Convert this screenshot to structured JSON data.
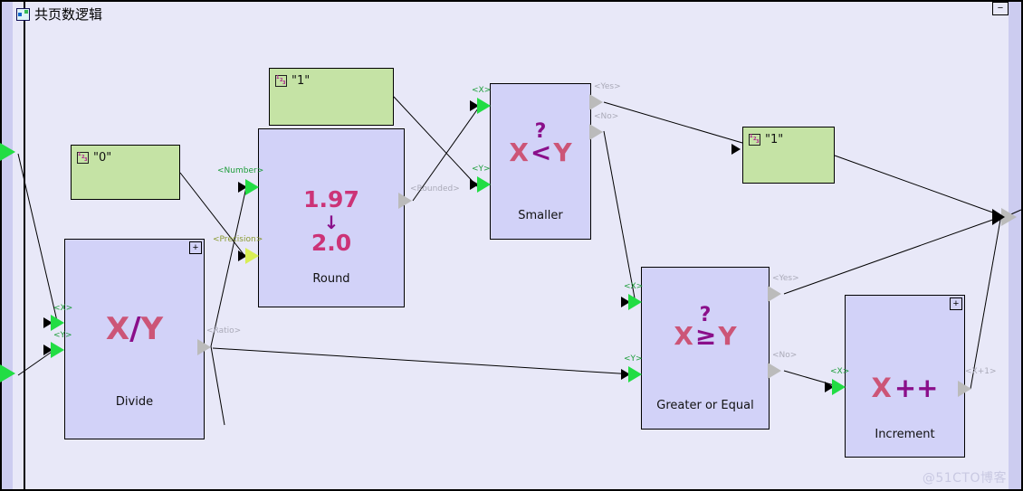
{
  "window": {
    "title": "共页数逻辑",
    "title_icon": "diagram-icon",
    "minimize_label": "−"
  },
  "watermark": "@51CTO博客",
  "colors": {
    "canvas_bg": "#e8e8f8",
    "node_fill": "#d2d2f8",
    "constant_fill": "#c5e3a5",
    "glyph_pink": "#cc4477",
    "glyph_purple": "#8a0f8a",
    "input_port": "#22dd44",
    "optional_port": "#d8ee55",
    "output_port": "#bbbbbb"
  },
  "nodes": [
    {
      "id": "divide",
      "label": "Divide",
      "glyph": "X/Y",
      "expander": "+",
      "inputs": [
        {
          "label": "<X>",
          "kind": "required"
        },
        {
          "label": "<Y>",
          "kind": "required"
        }
      ],
      "outputs": [
        {
          "label": "<Ratio>"
        }
      ]
    },
    {
      "id": "round",
      "label": "Round",
      "glyph": "1.97 ↓ 2.0",
      "glyph_top": "1.97",
      "glyph_arrow": "↓",
      "glyph_bottom": "2.0",
      "inputs": [
        {
          "label": "<Number>",
          "kind": "required"
        },
        {
          "label": "<Precision>",
          "kind": "optional"
        }
      ],
      "outputs": [
        {
          "label": "<Rounded>"
        }
      ]
    },
    {
      "id": "smaller",
      "label": "Smaller",
      "glyph": "X ? < Y",
      "glyph_q": "?",
      "glyph_x": "X",
      "glyph_op": "<",
      "glyph_y": "Y",
      "inputs": [
        {
          "label": "<X>",
          "kind": "required"
        },
        {
          "label": "<Y>",
          "kind": "required"
        }
      ],
      "outputs": [
        {
          "label": "<Yes>"
        },
        {
          "label": "<No>"
        }
      ]
    },
    {
      "id": "greater-or-equal",
      "label": "Greater or Equal",
      "glyph": "X ? ≥ Y",
      "glyph_q": "?",
      "glyph_x": "X",
      "glyph_op": "≥",
      "glyph_y": "Y",
      "inputs": [
        {
          "label": "<X>",
          "kind": "required"
        },
        {
          "label": "<Y>",
          "kind": "required"
        }
      ],
      "outputs": [
        {
          "label": "<Yes>"
        },
        {
          "label": "<No>"
        }
      ]
    },
    {
      "id": "increment",
      "label": "Increment",
      "glyph": "X++",
      "glyph_x": "X",
      "glyph_op": "++",
      "expander": "+",
      "inputs": [
        {
          "label": "<X>",
          "kind": "required"
        }
      ],
      "outputs": [
        {
          "label": "<X+1>"
        }
      ]
    }
  ],
  "constants": [
    {
      "id": "const-zero",
      "value": "\"0\"",
      "icon": "number-icon"
    },
    {
      "id": "const-one-top",
      "value": "\"1\"",
      "icon": "number-icon"
    },
    {
      "id": "const-one-right",
      "value": "\"1\"",
      "icon": "number-icon"
    }
  ],
  "port_labels": {
    "x": "<X>",
    "y": "<Y>",
    "ratio": "<Ratio>",
    "number": "<Number>",
    "precision": "<Precision>",
    "rounded": "<Rounded>",
    "yes": "<Yes>",
    "no": "<No>",
    "x_plus_1": "<X+1>"
  },
  "num_icon_digits": {
    "d1": "1",
    "d2": "2",
    "d3": "3"
  }
}
